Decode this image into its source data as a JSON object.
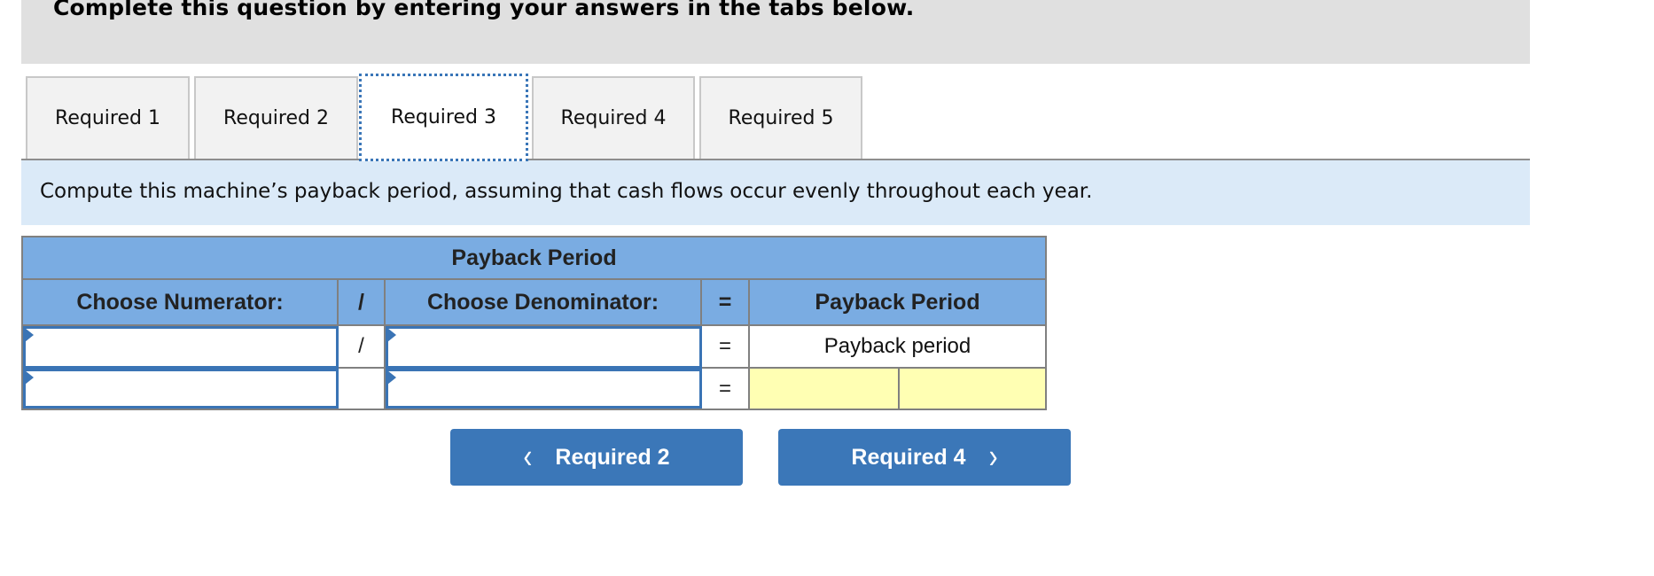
{
  "header": {
    "instruction_title": "Complete this question by entering your answers in the tabs below."
  },
  "tabs": [
    {
      "label": "Required 1",
      "active": false
    },
    {
      "label": "Required 2",
      "active": false
    },
    {
      "label": "Required 3",
      "active": true
    },
    {
      "label": "Required 4",
      "active": false
    },
    {
      "label": "Required 5",
      "active": false
    }
  ],
  "question": {
    "text": "Compute this machine’s payback period, assuming that cash flows occur evenly throughout each year."
  },
  "payback_table": {
    "title": "Payback Period",
    "headers": {
      "numerator": "Choose Numerator:",
      "divide": "/",
      "denominator": "Choose Denominator:",
      "equals": "=",
      "result": "Payback Period"
    },
    "rows": [
      {
        "numerator": "",
        "operator": "/",
        "denominator": "",
        "equals": "=",
        "result": "Payback period"
      },
      {
        "numerator": "",
        "operator": "",
        "denominator": "",
        "equals": "=",
        "result_value": "",
        "result_unit": ""
      }
    ]
  },
  "navigation": {
    "prev_label": "Required 2",
    "next_label": "Required 4",
    "prev_icon": "‹",
    "next_icon": "›"
  },
  "colors": {
    "header_blue": "#7aace2",
    "button_blue": "#3b77b8",
    "input_border": "#3a74b5",
    "answer_yellow": "#ffffb3",
    "instruction_band": "#dbeaf8"
  }
}
